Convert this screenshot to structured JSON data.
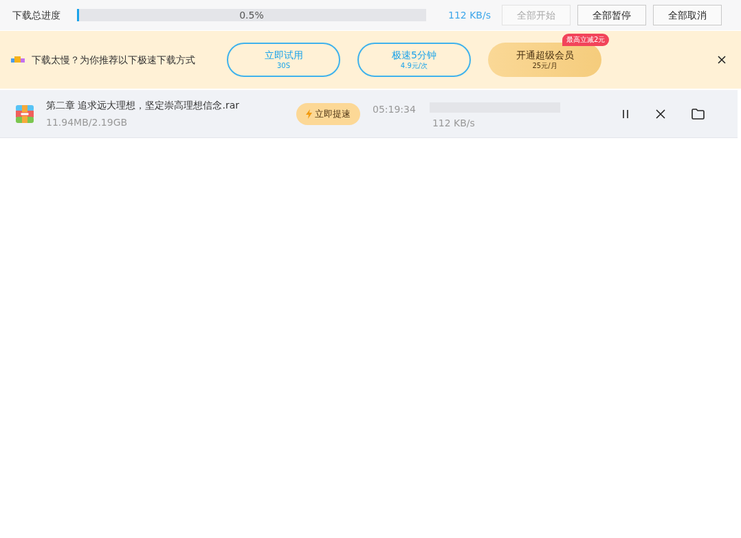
{
  "toolbar": {
    "label": "下载总进度",
    "progress": {
      "level": 0.005,
      "reading": "0.5%"
    },
    "speed": "112 KB/s",
    "buttons": [
      {
        "label": "全部开始",
        "disabled": true
      },
      {
        "label": "全部暂停",
        "disabled": false
      },
      {
        "label": "全部取消",
        "disabled": false
      }
    ]
  },
  "promo": {
    "message": "下载太慢？为你推荐以下极速下载方式",
    "options": [
      {
        "kind": "outline",
        "title": "立即试用",
        "subtitle": "30S"
      },
      {
        "kind": "outline",
        "title": "极速5分钟",
        "subtitle": "4.9元/次"
      },
      {
        "kind": "gold",
        "title": "开通超级会员",
        "subtitle": "25元/月",
        "badge": "最高立减2元"
      }
    ]
  },
  "downloads": [
    {
      "name": "第二章 追求远大理想，坚定崇高理想信念.rar",
      "size": "11.94MB/2.19GB",
      "boost": "立即提速",
      "time": "05:19:34",
      "speed": "112 KB/s"
    }
  ]
}
